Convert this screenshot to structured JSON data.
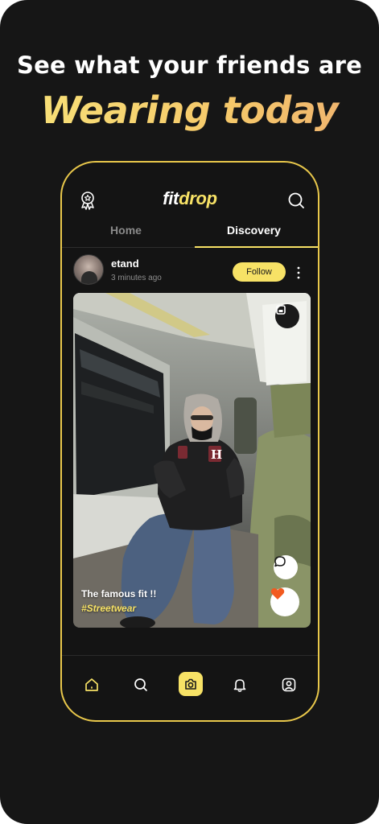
{
  "promo": {
    "line1": "See what your friends are",
    "line2": "Wearing today"
  },
  "app": {
    "logo_part1": "fit",
    "logo_part2": "drop"
  },
  "tabs": [
    {
      "label": "Home",
      "active": false
    },
    {
      "label": "Discovery",
      "active": true
    }
  ],
  "post": {
    "username": "etand",
    "timestamp": "3 minutes ago",
    "follow_label": "Follow",
    "caption": "The famous fit !!",
    "hashtag": "#Streetwear"
  },
  "icons": {
    "top_left": "award-icon",
    "top_right": "search-icon",
    "nav": [
      "home-icon",
      "search-icon",
      "camera-icon",
      "bell-icon",
      "profile-icon"
    ],
    "post_actions": [
      "bookmark-icon",
      "comment-icon",
      "heart-icon"
    ]
  },
  "colors": {
    "accent": "#f7e266",
    "background": "#161616",
    "like": "#f25a1f"
  }
}
